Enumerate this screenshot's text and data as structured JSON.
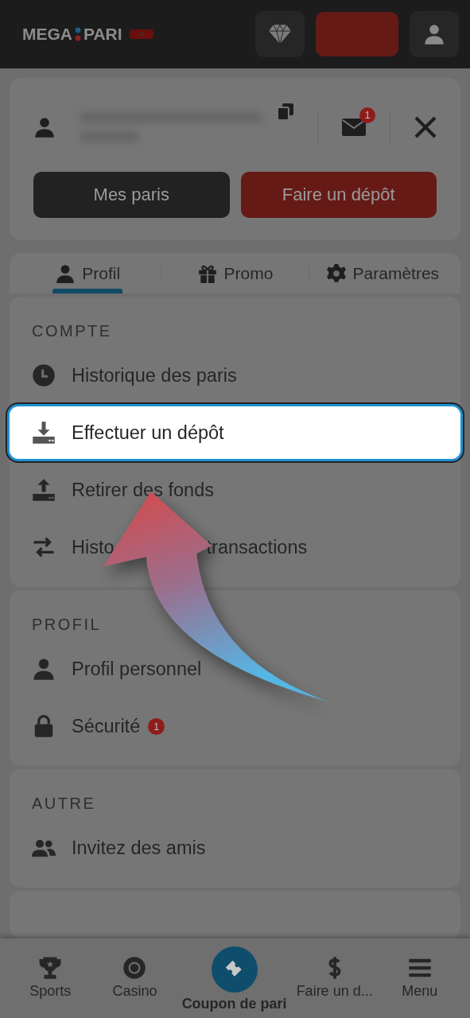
{
  "header": {
    "logo_left": "MEGA",
    "logo_right": "PARI"
  },
  "account": {
    "message_count": "1",
    "buttons": [
      {
        "label": "Mes paris",
        "kind": "dark"
      },
      {
        "label": "Faire un dépôt",
        "kind": "primary"
      }
    ]
  },
  "tabs": [
    {
      "label": "Profil",
      "kind": "profile",
      "selected": true
    },
    {
      "label": "Promo",
      "kind": "gift",
      "selected": false
    },
    {
      "label": "Paramètres",
      "kind": "gear",
      "selected": false
    }
  ],
  "sections": [
    {
      "title": "COMPTE",
      "items": [
        {
          "label": "Historique des paris",
          "kind": "clock",
          "highlighted": false
        },
        {
          "label": "Effectuer un dépôt",
          "kind": "download",
          "highlighted": true
        },
        {
          "label": "Retirer des fonds",
          "kind": "upload",
          "highlighted": false
        },
        {
          "label": "Histo",
          "label_after": "transactions",
          "kind": "swap",
          "highlighted": false
        }
      ]
    },
    {
      "title": "PROFIL",
      "items": [
        {
          "label": "Profil personnel",
          "kind": "person",
          "highlighted": false
        },
        {
          "label": "Sécurité",
          "kind": "lock",
          "highlighted": false,
          "badge": "1"
        }
      ]
    },
    {
      "title": "AUTRE",
      "items": [
        {
          "label": "Invitez des amis",
          "kind": "people",
          "highlighted": false
        }
      ]
    }
  ],
  "bottom_nav": [
    {
      "label": "Sports",
      "kind": "trophy",
      "selected": false
    },
    {
      "label": "Casino",
      "kind": "chip",
      "selected": false
    },
    {
      "label": "Coupon de pari",
      "kind": "ticket",
      "selected": true
    },
    {
      "label": "Faire un d...",
      "kind": "dollar",
      "selected": false
    },
    {
      "label": "Menu",
      "kind": "menu",
      "selected": false
    }
  ]
}
